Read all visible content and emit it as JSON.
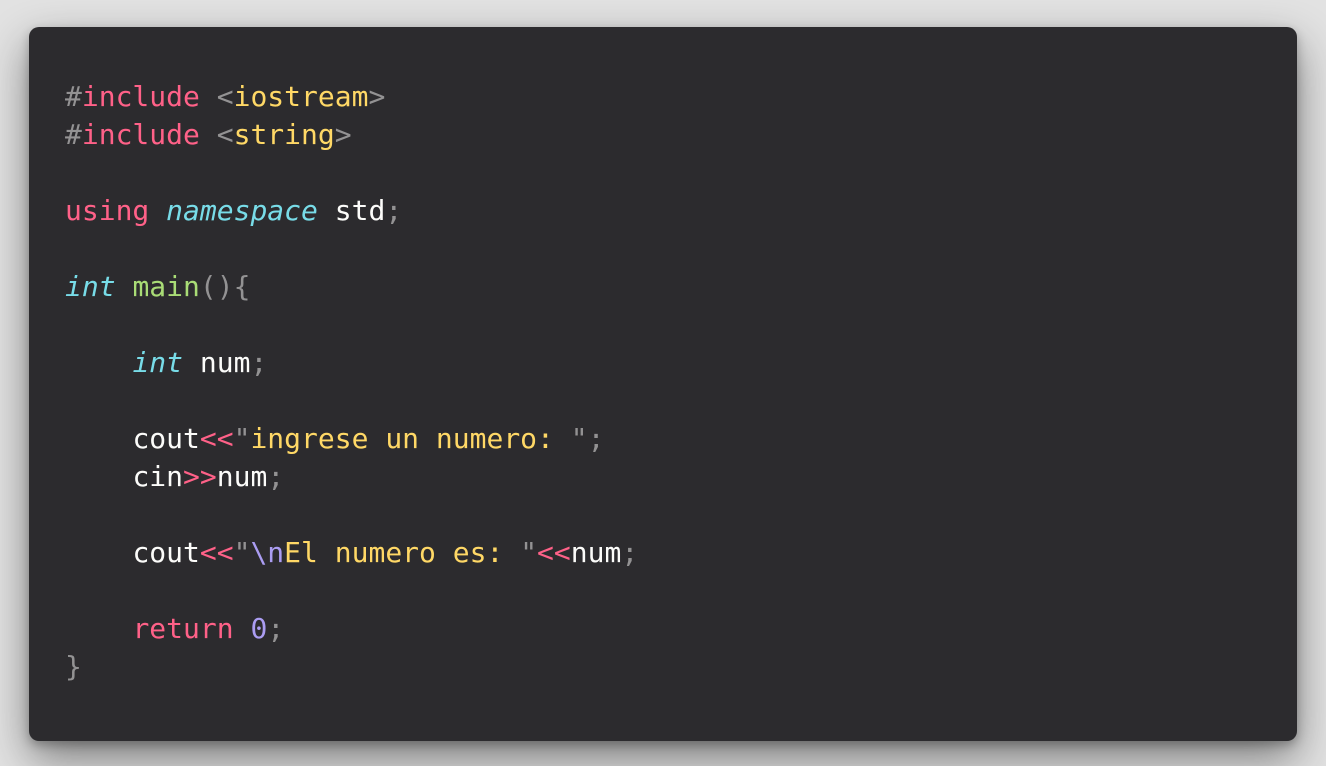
{
  "colors": {
    "background": "#2c2b2e",
    "text": "#fcfcfa",
    "keyword": "#ff6188",
    "punctuation": "#939293",
    "string": "#ffd866",
    "type": "#78dce8",
    "function": "#a9dc76",
    "number": "#ab9df2"
  },
  "code": {
    "lines": [
      [
        {
          "t": "#",
          "c": "pre"
        },
        {
          "t": "include",
          "c": "kw"
        },
        {
          "t": " ",
          "c": "id"
        },
        {
          "t": "<",
          "c": "punc"
        },
        {
          "t": "iostream",
          "c": "str"
        },
        {
          "t": ">",
          "c": "punc"
        }
      ],
      [
        {
          "t": "#",
          "c": "pre"
        },
        {
          "t": "include",
          "c": "kw"
        },
        {
          "t": " ",
          "c": "id"
        },
        {
          "t": "<",
          "c": "punc"
        },
        {
          "t": "string",
          "c": "str"
        },
        {
          "t": ">",
          "c": "punc"
        }
      ],
      [],
      [
        {
          "t": "using",
          "c": "kw"
        },
        {
          "t": " ",
          "c": "id"
        },
        {
          "t": "namespace",
          "c": "type"
        },
        {
          "t": " ",
          "c": "id"
        },
        {
          "t": "std",
          "c": "id"
        },
        {
          "t": ";",
          "c": "punc"
        }
      ],
      [],
      [
        {
          "t": "int",
          "c": "type"
        },
        {
          "t": " ",
          "c": "id"
        },
        {
          "t": "main",
          "c": "fn"
        },
        {
          "t": "(){",
          "c": "punc"
        }
      ],
      [],
      [
        {
          "t": "    ",
          "c": "id"
        },
        {
          "t": "int",
          "c": "type"
        },
        {
          "t": " ",
          "c": "id"
        },
        {
          "t": "num",
          "c": "id"
        },
        {
          "t": ";",
          "c": "punc"
        }
      ],
      [],
      [
        {
          "t": "    ",
          "c": "id"
        },
        {
          "t": "cout",
          "c": "id"
        },
        {
          "t": "<<",
          "c": "op"
        },
        {
          "t": "\"",
          "c": "punc"
        },
        {
          "t": "ingrese un numero: ",
          "c": "str"
        },
        {
          "t": "\"",
          "c": "punc"
        },
        {
          "t": ";",
          "c": "punc"
        }
      ],
      [
        {
          "t": "    ",
          "c": "id"
        },
        {
          "t": "cin",
          "c": "id"
        },
        {
          "t": ">>",
          "c": "op"
        },
        {
          "t": "num",
          "c": "id"
        },
        {
          "t": ";",
          "c": "punc"
        }
      ],
      [],
      [
        {
          "t": "    ",
          "c": "id"
        },
        {
          "t": "cout",
          "c": "id"
        },
        {
          "t": "<<",
          "c": "op"
        },
        {
          "t": "\"",
          "c": "punc"
        },
        {
          "t": "\\n",
          "c": "esc"
        },
        {
          "t": "El numero es: ",
          "c": "str"
        },
        {
          "t": "\"",
          "c": "punc"
        },
        {
          "t": "<<",
          "c": "op"
        },
        {
          "t": "num",
          "c": "id"
        },
        {
          "t": ";",
          "c": "punc"
        }
      ],
      [],
      [
        {
          "t": "    ",
          "c": "id"
        },
        {
          "t": "return",
          "c": "kw"
        },
        {
          "t": " ",
          "c": "id"
        },
        {
          "t": "0",
          "c": "num"
        },
        {
          "t": ";",
          "c": "punc"
        }
      ],
      [
        {
          "t": "}",
          "c": "punc"
        }
      ]
    ]
  }
}
